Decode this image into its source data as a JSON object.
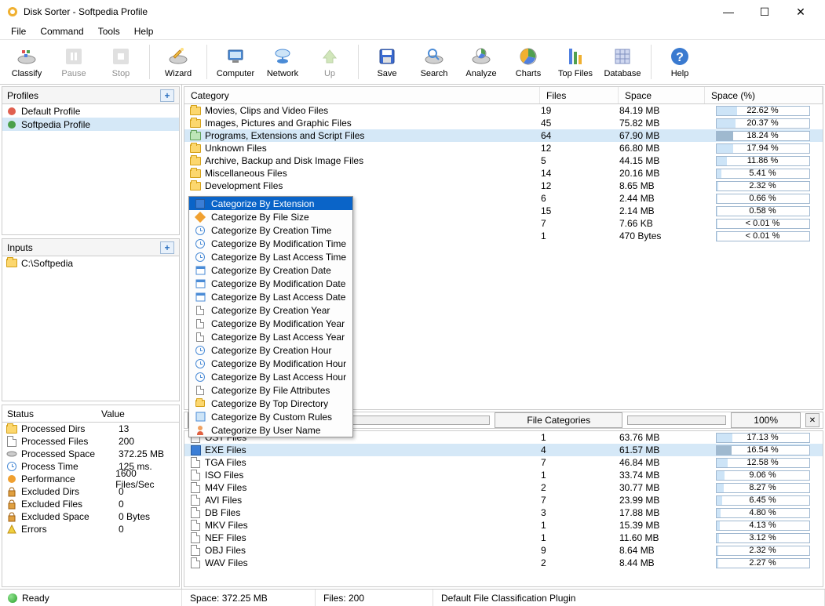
{
  "window": {
    "title": "Disk Sorter - Softpedia Profile"
  },
  "menubar": [
    "File",
    "Command",
    "Tools",
    "Help"
  ],
  "toolbar": [
    {
      "name": "classify",
      "label": "Classify",
      "icon": "classify",
      "disabled": false
    },
    {
      "name": "pause",
      "label": "Pause",
      "icon": "pause",
      "disabled": true
    },
    {
      "name": "stop",
      "label": "Stop",
      "icon": "stop",
      "disabled": true
    },
    {
      "sep": true
    },
    {
      "name": "wizard",
      "label": "Wizard",
      "icon": "wizard",
      "disabled": false
    },
    {
      "sep": true
    },
    {
      "name": "computer",
      "label": "Computer",
      "icon": "computer",
      "disabled": false
    },
    {
      "name": "network",
      "label": "Network",
      "icon": "network",
      "disabled": false
    },
    {
      "name": "up",
      "label": "Up",
      "icon": "up",
      "disabled": true
    },
    {
      "sep": true
    },
    {
      "name": "save",
      "label": "Save",
      "icon": "save",
      "disabled": false
    },
    {
      "name": "search",
      "label": "Search",
      "icon": "search",
      "disabled": false
    },
    {
      "name": "analyze",
      "label": "Analyze",
      "icon": "analyze",
      "disabled": false
    },
    {
      "name": "charts",
      "label": "Charts",
      "icon": "charts",
      "disabled": false
    },
    {
      "name": "topfiles",
      "label": "Top Files",
      "icon": "topfiles",
      "disabled": false
    },
    {
      "name": "database",
      "label": "Database",
      "icon": "database",
      "disabled": false
    },
    {
      "sep": true
    },
    {
      "name": "help",
      "label": "Help",
      "icon": "help",
      "disabled": false
    }
  ],
  "profiles": {
    "header": "Profiles",
    "items": [
      {
        "label": "Default Profile",
        "color": "#e06050",
        "selected": false
      },
      {
        "label": "Softpedia Profile",
        "color": "#4aa04a",
        "selected": true
      }
    ]
  },
  "inputs": {
    "header": "Inputs",
    "items": [
      {
        "label": "C:\\Softpedia"
      }
    ]
  },
  "status_panel": {
    "headers": [
      "Status",
      "Value"
    ],
    "rows": [
      {
        "label": "Processed Dirs",
        "value": "13",
        "icon": "folder"
      },
      {
        "label": "Processed Files",
        "value": "200",
        "icon": "file"
      },
      {
        "label": "Processed Space",
        "value": "372.25 MB",
        "icon": "disk"
      },
      {
        "label": "Process Time",
        "value": "125 ms.",
        "icon": "clock"
      },
      {
        "label": "Performance",
        "value": "1600 Files/Sec",
        "icon": "gauge"
      },
      {
        "label": "Excluded Dirs",
        "value": "0",
        "icon": "lock"
      },
      {
        "label": "Excluded Files",
        "value": "0",
        "icon": "lock"
      },
      {
        "label": "Excluded Space",
        "value": "0 Bytes",
        "icon": "lock"
      },
      {
        "label": "Errors",
        "value": "0",
        "icon": "warn"
      }
    ]
  },
  "main_grid": {
    "headers": {
      "category": "Category",
      "files": "Files",
      "space": "Space",
      "pct": "Space (%)"
    },
    "rows": [
      {
        "cat": "Movies, Clips and Video Files",
        "files": "19",
        "space": "84.19 MB",
        "pct": "22.62 %",
        "fill": 22.62,
        "icon": "folder"
      },
      {
        "cat": "Images, Pictures and Graphic Files",
        "files": "45",
        "space": "75.82 MB",
        "pct": "20.37 %",
        "fill": 20.37,
        "icon": "folder"
      },
      {
        "cat": "Programs, Extensions and Script Files",
        "files": "64",
        "space": "67.90 MB",
        "pct": "18.24 %",
        "fill": 18.24,
        "icon": "folder-open",
        "selected": true
      },
      {
        "cat": "Unknown Files",
        "files": "12",
        "space": "66.80 MB",
        "pct": "17.94 %",
        "fill": 17.94,
        "icon": "folder"
      },
      {
        "cat": "Archive, Backup and Disk Image Files",
        "files": "5",
        "space": "44.15 MB",
        "pct": "11.86 %",
        "fill": 11.86,
        "icon": "folder"
      },
      {
        "cat": "Miscellaneous Files",
        "files": "14",
        "space": "20.16 MB",
        "pct": "5.41 %",
        "fill": 5.41,
        "icon": "folder"
      },
      {
        "cat": "Development Files",
        "files": "12",
        "space": "8.65 MB",
        "pct": "2.32 %",
        "fill": 2.32,
        "icon": "folder"
      },
      {
        "cat": "",
        "files": "6",
        "space": "2.44 MB",
        "pct": "0.66 %",
        "fill": 0.66,
        "hidden_cat": true
      },
      {
        "cat": "",
        "files": "15",
        "space": "2.14 MB",
        "pct": "0.58 %",
        "fill": 0.58,
        "hidden_cat": true
      },
      {
        "cat": "",
        "files": "7",
        "space": "7.66 KB",
        "pct": "< 0.01 %",
        "fill": 0.3,
        "hidden_cat": true
      },
      {
        "cat": "",
        "files": "1",
        "space": "470 Bytes",
        "pct": "< 0.01 %",
        "fill": 0.2,
        "hidden_cat": true
      }
    ]
  },
  "context_menu": [
    {
      "label": "Categorize By Extension",
      "icon": "grid",
      "selected": true
    },
    {
      "label": "Categorize By File Size",
      "icon": "diamond"
    },
    {
      "label": "Categorize By Creation Time",
      "icon": "clock"
    },
    {
      "label": "Categorize By Modification Time",
      "icon": "clock"
    },
    {
      "label": "Categorize By Last Access Time",
      "icon": "clock"
    },
    {
      "label": "Categorize By Creation Date",
      "icon": "cal"
    },
    {
      "label": "Categorize By Modification Date",
      "icon": "cal"
    },
    {
      "label": "Categorize By Last Access Date",
      "icon": "cal"
    },
    {
      "label": "Categorize By Creation Year",
      "icon": "doc"
    },
    {
      "label": "Categorize By Modification Year",
      "icon": "doc"
    },
    {
      "label": "Categorize By Last Access Year",
      "icon": "doc"
    },
    {
      "label": "Categorize By Creation Hour",
      "icon": "clock"
    },
    {
      "label": "Categorize By Modification Hour",
      "icon": "clock"
    },
    {
      "label": "Categorize By Last Access Hour",
      "icon": "clock"
    },
    {
      "label": "Categorize By File Attributes",
      "icon": "doc"
    },
    {
      "label": "Categorize By Top Directory",
      "icon": "folder"
    },
    {
      "label": "Categorize By Custom Rules",
      "icon": "rules"
    },
    {
      "label": "Categorize By User Name",
      "icon": "user"
    }
  ],
  "middle_bar": {
    "combo_value": "Categorize By Extension",
    "segment_label": "File Categories",
    "zoom_label": "100%"
  },
  "bottom_grid": {
    "rows": [
      {
        "cat": "OST Files",
        "files": "1",
        "space": "63.76 MB",
        "pct": "17.13 %",
        "fill": 17.13,
        "icon": "file"
      },
      {
        "cat": "EXE Files",
        "files": "4",
        "space": "61.57 MB",
        "pct": "16.54 %",
        "fill": 16.54,
        "icon": "exe",
        "selected": true
      },
      {
        "cat": "TGA Files",
        "files": "7",
        "space": "46.84 MB",
        "pct": "12.58 %",
        "fill": 12.58,
        "icon": "file"
      },
      {
        "cat": "ISO Files",
        "files": "1",
        "space": "33.74 MB",
        "pct": "9.06 %",
        "fill": 9.06,
        "icon": "iso"
      },
      {
        "cat": "M4V Files",
        "files": "2",
        "space": "30.77 MB",
        "pct": "8.27 %",
        "fill": 8.27,
        "icon": "file"
      },
      {
        "cat": "AVI Files",
        "files": "7",
        "space": "23.99 MB",
        "pct": "6.45 %",
        "fill": 6.45,
        "icon": "avi"
      },
      {
        "cat": "DB Files",
        "files": "3",
        "space": "17.88 MB",
        "pct": "4.80 %",
        "fill": 4.8,
        "icon": "db"
      },
      {
        "cat": "MKV Files",
        "files": "1",
        "space": "15.39 MB",
        "pct": "4.13 %",
        "fill": 4.13,
        "icon": "file"
      },
      {
        "cat": "NEF Files",
        "files": "1",
        "space": "11.60 MB",
        "pct": "3.12 %",
        "fill": 3.12,
        "icon": "file"
      },
      {
        "cat": "OBJ Files",
        "files": "9",
        "space": "8.64 MB",
        "pct": "2.32 %",
        "fill": 2.32,
        "icon": "obj"
      },
      {
        "cat": "WAV Files",
        "files": "2",
        "space": "8.44 MB",
        "pct": "2.27 %",
        "fill": 2.27,
        "icon": "wav"
      }
    ]
  },
  "statusbar": {
    "ready": "Ready",
    "space": "Space: 372.25 MB",
    "files": "Files: 200",
    "plugin": "Default File Classification Plugin"
  }
}
